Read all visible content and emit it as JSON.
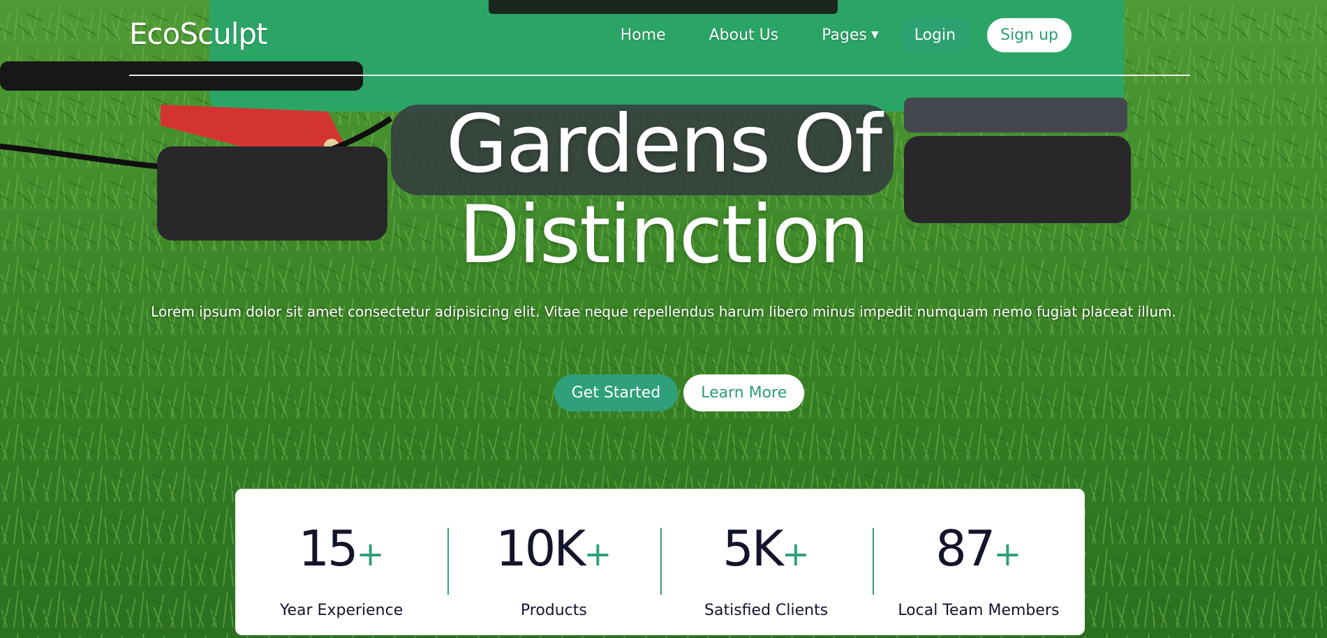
{
  "brand": "EcoSculpt",
  "nav": {
    "items": [
      "Home",
      "About Us",
      "Pages"
    ],
    "dropdown_icon": "caret-down-icon",
    "login": "Login",
    "signup": "Sign up"
  },
  "hero": {
    "title_line1": "Gardens Of",
    "title_line2": "Distinction",
    "text": "Lorem ipsum dolor sit amet consectetur adipisicing elit. Vitae neque repellendus harum libero minus impedit numquam nemo fugiat placeat illum.",
    "primary_button": "Get Started",
    "secondary_button": "Learn More"
  },
  "stats": [
    {
      "value": "15",
      "suffix": "+",
      "label": "Year Experience"
    },
    {
      "value": "10K",
      "suffix": "+",
      "label": "Products"
    },
    {
      "value": "5K",
      "suffix": "+",
      "label": "Satisfied Clients"
    },
    {
      "value": "87",
      "suffix": "+",
      "label": "Local Team Members"
    }
  ],
  "colors": {
    "accent": "#2fa07b",
    "dark_text": "#14142b",
    "grass": "#3f8a2c",
    "mower": "#2fb36f"
  }
}
